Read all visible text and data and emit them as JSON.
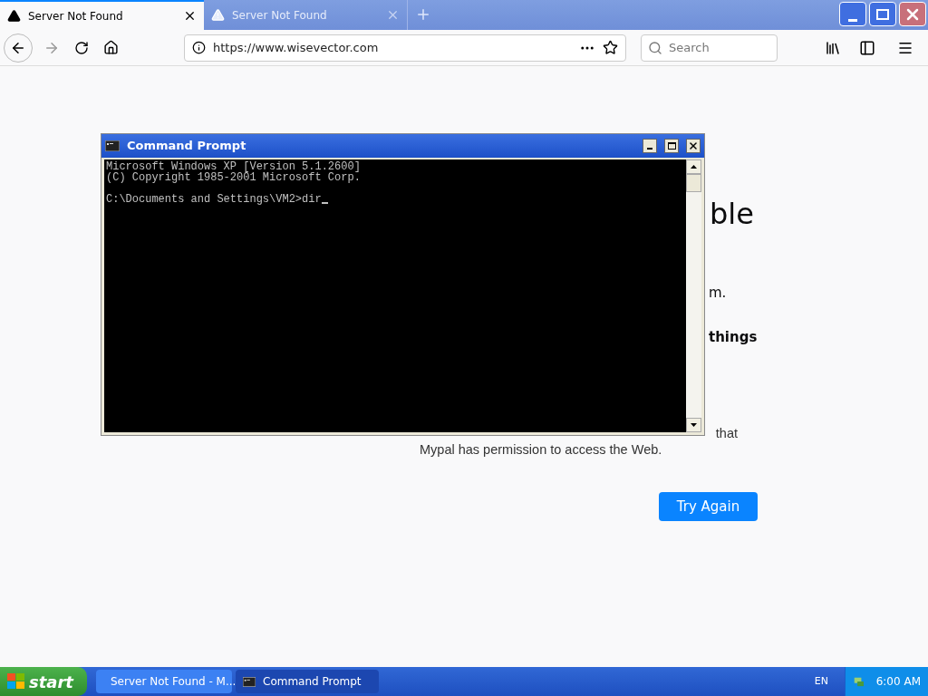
{
  "browser": {
    "tabs": [
      {
        "title": "Server Not Found",
        "selected": true
      },
      {
        "title": "Server Not Found",
        "selected": false
      }
    ],
    "url": "https://www.wisevector.com",
    "search": {
      "placeholder": "Search"
    }
  },
  "page": {
    "title_fragment": "ble",
    "text_fragment": "m.",
    "bold_fragment": "things",
    "bullet": {
      "line_end": "that",
      "next_line": "Mypal has permission to access the Web."
    },
    "button": "Try Again"
  },
  "console": {
    "title": "Command Prompt",
    "blocks": [
      [
        "Microsoft Windows XP [Version 5.1.2600]",
        "(C) Copyright 1985-2001 Microsoft Corp."
      ],
      [
        "C:\\Documents and Settings\\VM2>dir"
      ]
    ]
  },
  "taskbar": {
    "start": "start",
    "tasks": [
      {
        "label": "Server Not Found - M...",
        "kind": "browser",
        "selected": false
      },
      {
        "label": "Command Prompt",
        "kind": "console",
        "selected": true
      }
    ],
    "language": "EN",
    "clock": "6:00 AM"
  }
}
